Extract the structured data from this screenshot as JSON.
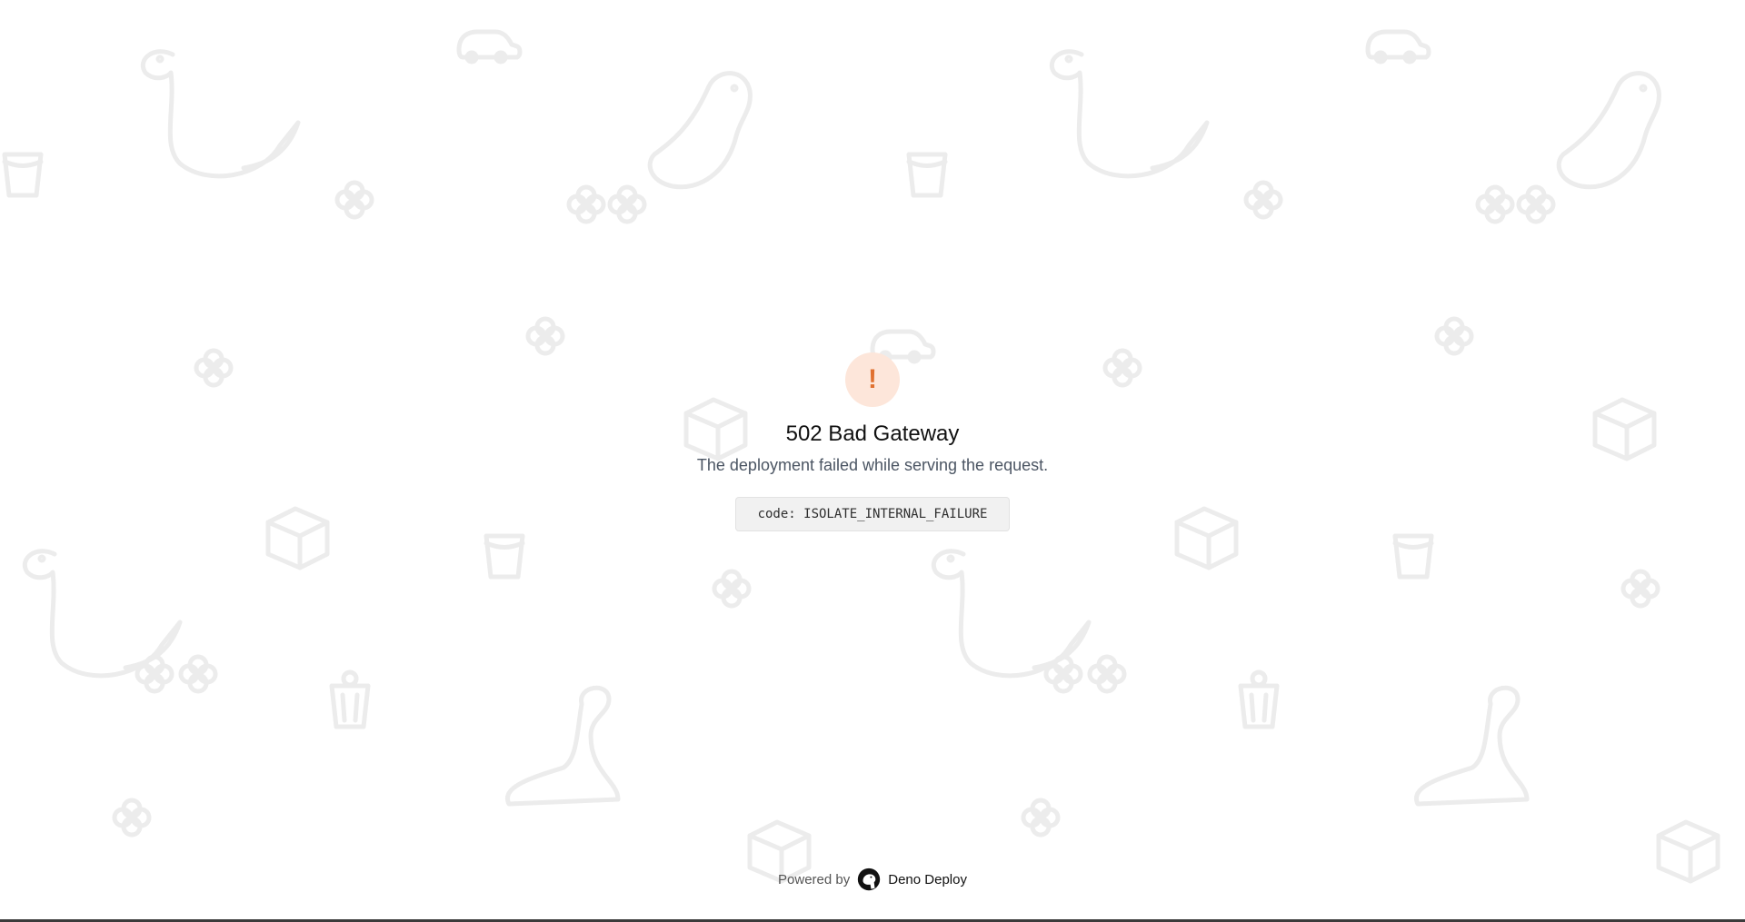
{
  "error": {
    "status": "502 Bad Gateway",
    "message": "The deployment failed while serving the request.",
    "code": "code: ISOLATE_INTERNAL_FAILURE",
    "icon": "exclamation-icon",
    "accent_color": "#e0702f",
    "accent_bg": "#fde6da"
  },
  "footer": {
    "powered_by": "Powered by",
    "brand": "Deno Deploy",
    "logo_icon": "deno-logo-icon"
  },
  "background": {
    "pattern_color": "#ececec",
    "icons": [
      "dinosaur-icon",
      "car-icon",
      "bucket-icon",
      "flower-icon",
      "box-icon",
      "trash-can-icon"
    ]
  }
}
